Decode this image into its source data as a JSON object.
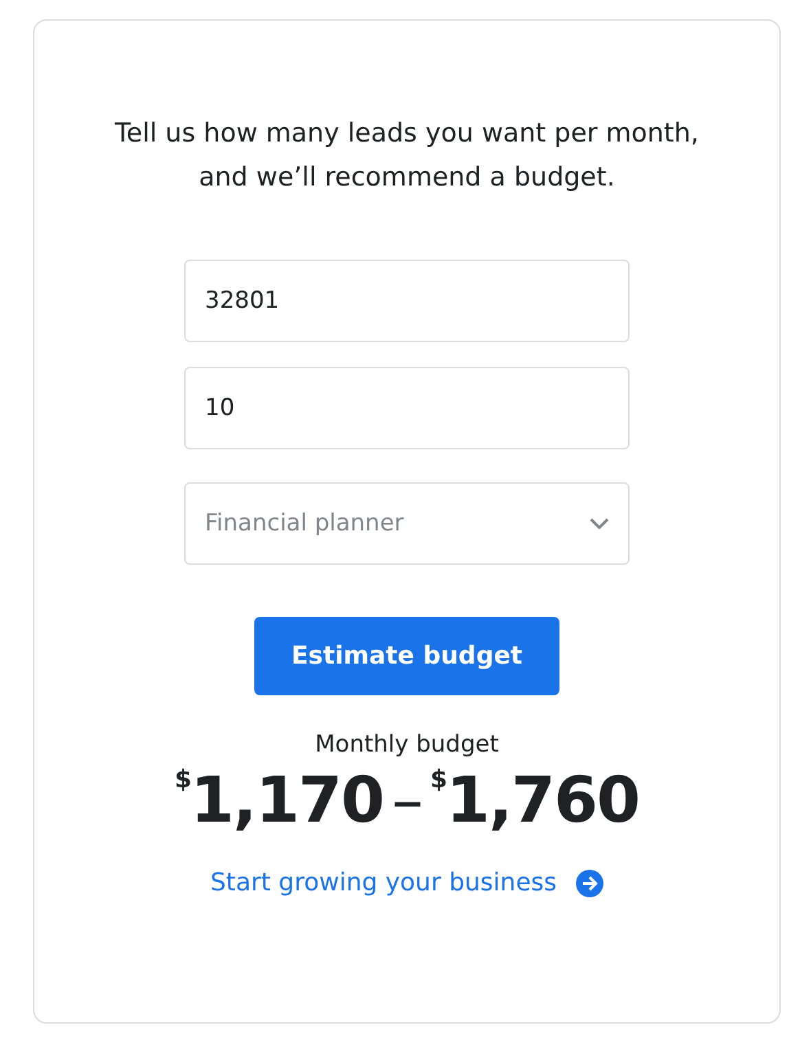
{
  "intro": "Tell us how many leads you want per month, and we’ll recommend a budget.",
  "fields": [
    {
      "kind": "text",
      "value": "32801"
    },
    {
      "kind": "text",
      "value": "10"
    },
    {
      "kind": "select",
      "placeholder": "Financial planner"
    }
  ],
  "button": "Estimate budget",
  "result": {
    "label": "Monthly budget",
    "currency": "$",
    "low": "1,170",
    "separator": "–",
    "high": "1,760"
  },
  "link": "Start growing your business"
}
